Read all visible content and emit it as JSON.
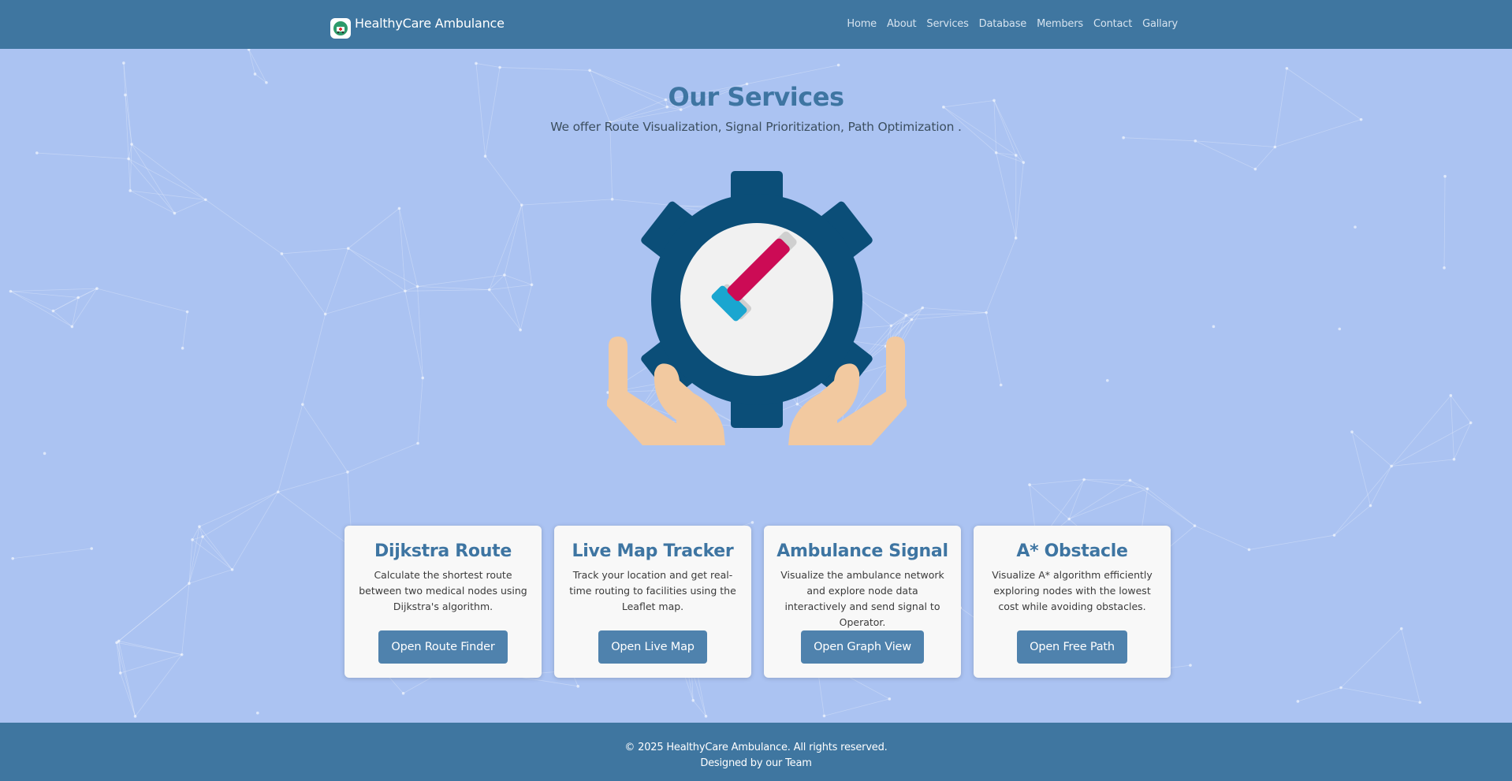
{
  "brand": {
    "title": "HealthyCare Ambulance",
    "logo_icon": "ambulance-logo-icon"
  },
  "nav": {
    "links": [
      "Home",
      "About",
      "Services",
      "Database",
      "Members",
      "Contact",
      "Gallary"
    ]
  },
  "hero": {
    "title": "Our Services",
    "subtitle": "We offer Route Visualization, Signal Prioritization, Path Optimization .",
    "illustration_icon": "gear-checkmark-hands-icon"
  },
  "cards": [
    {
      "title": "Dijkstra Route",
      "description": "Calculate the shortest route between two medical nodes using Dijkstra's algorithm.",
      "button": "Open Route Finder"
    },
    {
      "title": "Live Map Tracker",
      "description": "Track your location and get real-time routing to facilities using the Leaflet map.",
      "button": "Open Live Map"
    },
    {
      "title": "Ambulance Signal",
      "description": "Visualize the ambulance network and explore node data interactively and send signal to Operator.",
      "button": "Open Graph View"
    },
    {
      "title": "A* Obstacle",
      "description": "Visualize A* algorithm efficiently exploring nodes with the lowest cost while avoiding obstacles.",
      "button": "Open Free Path"
    }
  ],
  "footer": {
    "copyright": "© 2025 HealthyCare Ambulance. All rights reserved.",
    "credit": "Designed by our Team"
  },
  "colors": {
    "navbar": "#3f76a0",
    "background": "#abc3f2",
    "accent": "#3e75a2",
    "button": "#4f82ad",
    "gear": "#0b4e78",
    "check_primary": "#cc0b55",
    "check_secondary": "#1aa6d0"
  }
}
